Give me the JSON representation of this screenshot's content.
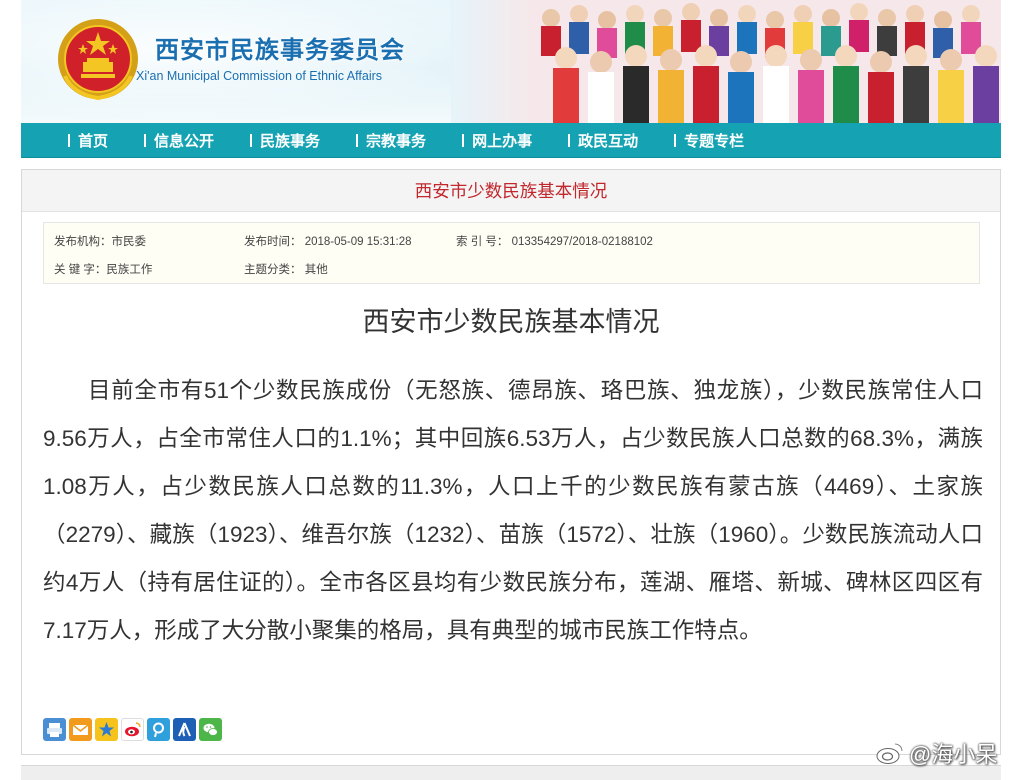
{
  "header": {
    "title_cn": "西安市民族事务委员会",
    "title_en": "Xi'an Municipal Commission of Ethnic Affairs"
  },
  "nav": {
    "items": [
      {
        "label": "首页"
      },
      {
        "label": "信息公开"
      },
      {
        "label": "民族事务"
      },
      {
        "label": "宗教事务"
      },
      {
        "label": "网上办事"
      },
      {
        "label": "政民互动"
      },
      {
        "label": "专题专栏"
      }
    ]
  },
  "page": {
    "heading": "西安市少数民族基本情况"
  },
  "meta": {
    "publisher": "发布机构：市民委",
    "date": "发布时间： 2018-05-09 15:31:28",
    "index": "索 引 号： 013354297/2018-02188102",
    "keywords": "关 键 字：民族工作",
    "category": "主题分类： 其他"
  },
  "article": {
    "title": "西安市少数民族基本情况",
    "body": "目前全市有51个少数民族成份（无怒族、德昂族、珞巴族、独龙族），少数民族常住人口9.56万人，占全市常住人口的1.1%；其中回族6.53万人，占少数民族人口总数的68.3%，满族1.08万人，占少数民族人口总数的11.3%，人口上千的少数民族有蒙古族（4469）、土家族（2279）、藏族（1923）、维吾尔族（1232）、苗族（1572）、壮族（1960）。少数民族流动人口约4万人（持有居住证的）。全市各区县均有少数民族分布，莲湖、雁塔、新城、碑林区四区有7.17万人，形成了大分散小聚集的格局，具有典型的城市民族工作特点。"
  },
  "share": {
    "icons": [
      "print-icon",
      "email-icon",
      "qzone-icon",
      "weibo-icon",
      "tencent-icon",
      "renren-icon",
      "wechat-icon"
    ]
  },
  "watermark": {
    "text": "@海小呆"
  },
  "colors": {
    "nav_bg": "#15a3b3",
    "heading_red": "#c1272d",
    "brand_blue": "#1a6fb1"
  }
}
